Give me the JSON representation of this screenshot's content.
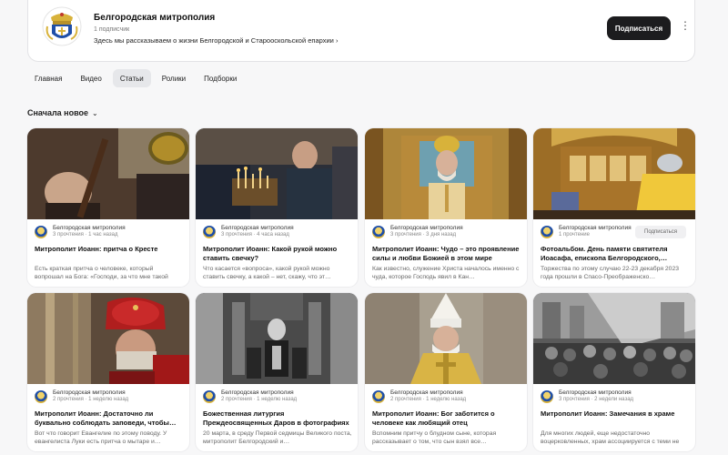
{
  "channel": {
    "title": "Белгородская митрополия",
    "subscribers": "1 подписчик",
    "description": "Здесь мы рассказываем о жизни Белгородской и Старооскольской епархии",
    "subscribe_label": "Подписаться",
    "more_icon": "more-vertical-icon",
    "brand_colors": {
      "blue": "#1f4fa8",
      "gold": "#d8b23a"
    }
  },
  "tabs": [
    {
      "label": "Главная"
    },
    {
      "label": "Видео"
    },
    {
      "label": "Статьи",
      "active": true
    },
    {
      "label": "Ролики"
    },
    {
      "label": "Подборки"
    }
  ],
  "sort": {
    "label": "Сначала новое",
    "icon": "chevron-down-icon"
  },
  "cards": [
    {
      "channel": "Белгородская митрополия",
      "stats": "3 прочтения · 1 час назад",
      "title": "Митрополит Иоанн: притча о Кресте",
      "snippet": "Есть краткая притча о человеке, который вопрошал на Бога: «Господи, за что мне такой крест? За что Ты посылаешь мне так…"
    },
    {
      "channel": "Белгородская митрополия",
      "stats": "3 прочтения · 4 часа назад",
      "title": "Митрополит Иоанн: Какой рукой можно ставить свечку?",
      "snippet": "Что касается «вопроса», какой рукой можно ставить свечку, а какой – нет, скажу, что эт…"
    },
    {
      "channel": "Белгородская митрополия",
      "stats": "3 прочтения · 3 дня назад",
      "title": "Митрополит Иоанн: Чудо – это проявление силы и любви Божией в этом мире",
      "snippet": "Как известно, служение Христа началось именно с чуда, которое Господь явил в Кан…"
    },
    {
      "channel": "Белгородская митрополия",
      "stats": "1 прочтение",
      "subscribe_label": "Подписаться",
      "title": "Фотоальбом. День памяти святителя Иоасафа, епископа Белгородского,…",
      "snippet": "Торжества по этому случаю 22-23 декабря 2023 года прошли в Спасо-Преображенско…"
    },
    {
      "channel": "Белгородская митрополия",
      "stats": "2 прочтения · 1 неделю назад",
      "title": "Митрополит Иоанн: Достаточно ли буквально соблюдать заповеди, чтобы…",
      "snippet": "Вот что говорит Евангелие по этому поводу. У евангелиста Луки есть притча о мытаре и…"
    },
    {
      "channel": "Белгородская митрополия",
      "stats": "2 прочтения · 1 неделю назад",
      "title": "Божественная литургия Преждеосвященных Даров в фотографиях",
      "snippet": "20 марта, в среду Первой седмицы Великого поста, митрополит Белгородский и…"
    },
    {
      "channel": "Белгородская митрополия",
      "stats": "2 прочтения · 1 неделю назад",
      "title": "Митрополит Иоанн: Бог заботится о человеке как любящий отец",
      "snippet": "Вспомним притчу о блудном сыне, которая рассказывает о том, что сын взял все…"
    },
    {
      "channel": "Белгородская митрополия",
      "stats": "3 прочтения · 2 недели назад",
      "title": "Митрополит Иоанн: Замечания в храме",
      "snippet": "Для многих людей, еще недостаточно воцерковленных, храм ассоциируется с теми не очень приветливыми прихожанками,…"
    }
  ]
}
